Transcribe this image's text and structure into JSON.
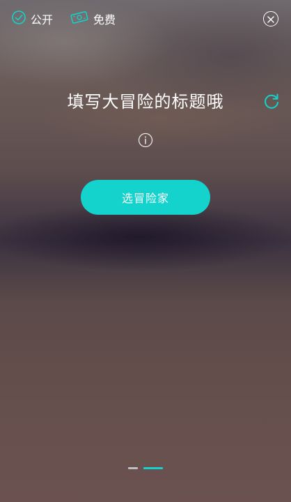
{
  "header": {
    "public_label": "公开",
    "free_label": "免费",
    "icons": {
      "public": "check-circle-icon",
      "free": "money-bill-icon",
      "close": "close-icon"
    }
  },
  "main": {
    "title": "填写大冒险的标题哦",
    "refresh_icon": "refresh-icon",
    "info_icon": "info-icon",
    "primary_button_label": "选冒险家"
  },
  "pager": {
    "pages": 2,
    "active_index": 1
  },
  "colors": {
    "accent": "#13d3cc",
    "text": "#ffffff",
    "inactive_dot": "#bfbfbf"
  }
}
